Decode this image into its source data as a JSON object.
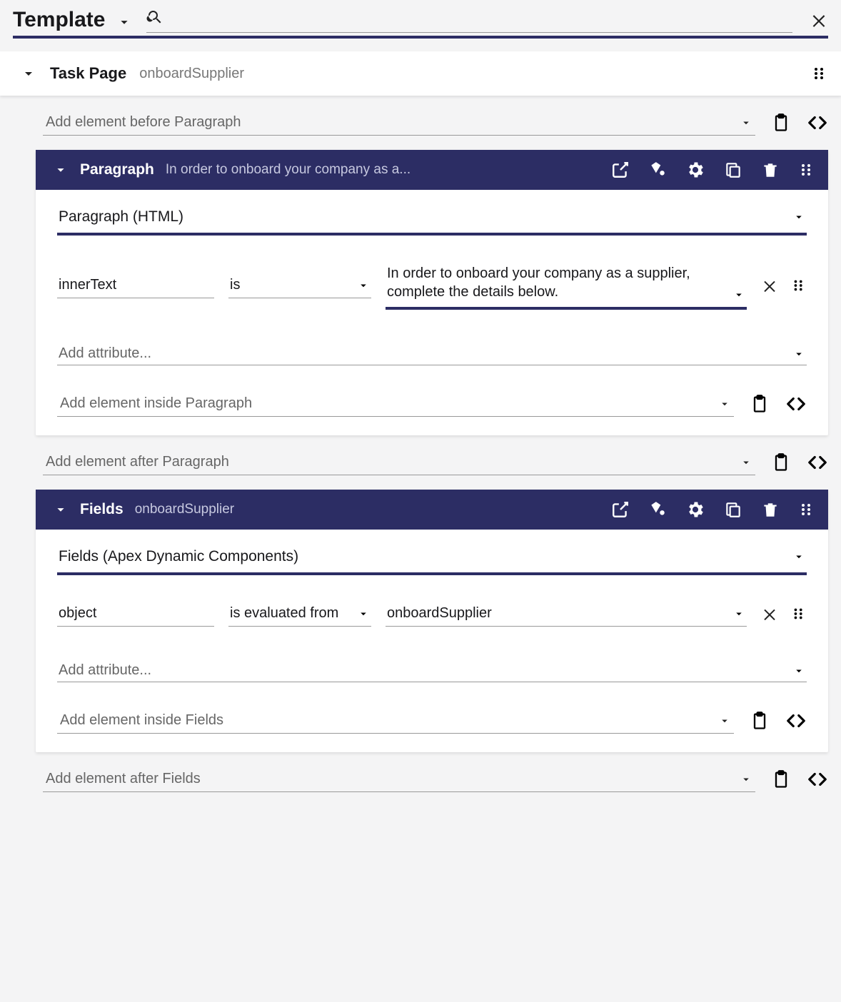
{
  "header": {
    "title": "Template"
  },
  "taskPage": {
    "title": "Task Page",
    "subtitle": "onboardSupplier"
  },
  "addBefore": {
    "paragraph": "Add element before Paragraph"
  },
  "sections": {
    "paragraph": {
      "title": "Paragraph",
      "preview": "In order to onboard your company as a...",
      "typeLabel": "Paragraph (HTML)",
      "attr": {
        "name": "innerText",
        "op": "is",
        "value": "In order to onboard your company as a supplier, complete the details below."
      },
      "addAttr": "Add attribute...",
      "addInside": "Add element inside Paragraph",
      "addAfter": "Add element after Paragraph"
    },
    "fields": {
      "title": "Fields",
      "subtitle": "onboardSupplier",
      "typeLabel": "Fields (Apex Dynamic Components)",
      "attr": {
        "name": "object",
        "op": "is evaluated from",
        "value": "onboardSupplier"
      },
      "addAttr": "Add attribute...",
      "addInside": "Add element inside Fields",
      "addAfter": "Add element after Fields"
    }
  }
}
